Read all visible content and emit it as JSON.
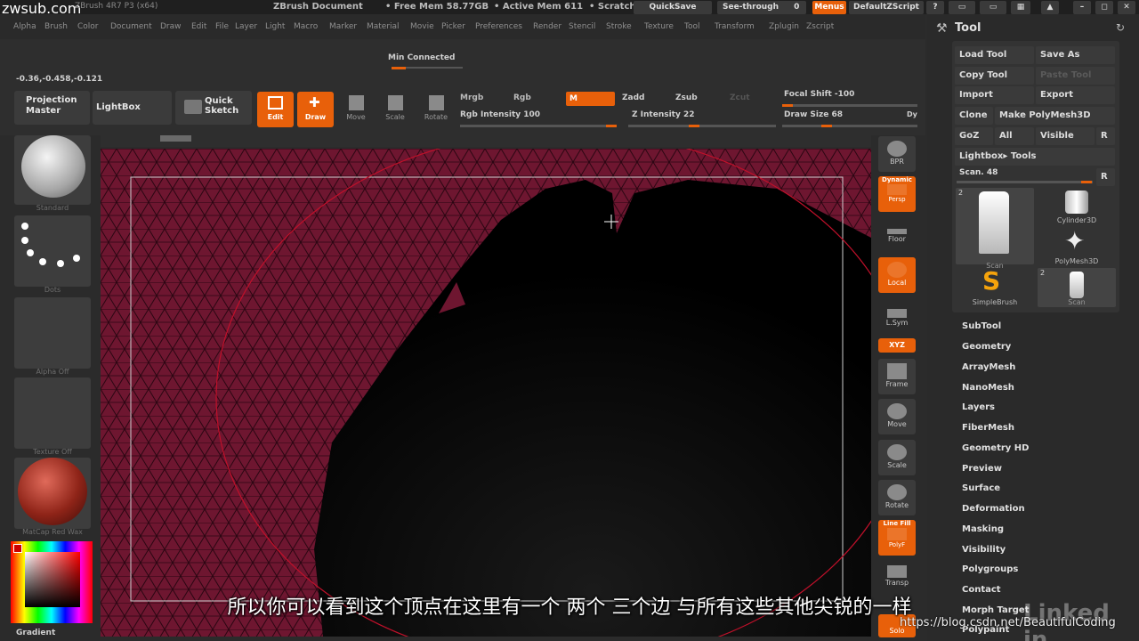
{
  "watermark": "zwsub.com",
  "titlebar": {
    "app_version": "ZBrush 4R7 P3 (x64)",
    "document": "ZBrush Document",
    "free_mem": "• Free Mem 58.77GB",
    "active_mem": "• Active Mem 611",
    "scratch": "• Scratch",
    "quicksave": "QuickSave",
    "see_through": "See-through",
    "see_through_value": "0",
    "menus": "Menus",
    "default_zscript": "DefaultZScript"
  },
  "menu": [
    "Alpha",
    "Brush",
    "Color",
    "Document",
    "Draw",
    "Edit",
    "File",
    "Layer",
    "Light",
    "Macro",
    "Marker",
    "Material",
    "Movie",
    "Picker",
    "Preferences",
    "Render",
    "Stencil",
    "Stroke",
    "Texture",
    "Tool",
    "Transform",
    "Zplugin",
    "Zscript"
  ],
  "status": {
    "connected": "Min Connected",
    "coords": "-0.36,-0.458,-0.121"
  },
  "toolbar": {
    "projection_master": "Projection Master",
    "lightbox": "LightBox",
    "quick_sketch": "Quick Sketch",
    "edit": "Edit",
    "draw": "Draw",
    "move": "Move",
    "scale": "Scale",
    "rotate": "Rotate",
    "mrgb": "Mrgb",
    "rgb": "Rgb",
    "m": "M",
    "zadd": "Zadd",
    "zsub": "Zsub",
    "zcut": "Zcut",
    "rgb_intensity": "Rgb Intensity 100",
    "z_intensity": "Z Intensity 22",
    "focal_shift": "Focal Shift -100",
    "draw_size": "Draw Size 68",
    "dyn": "Dy"
  },
  "left_shelf": {
    "standard": "Standard",
    "dots": "Dots",
    "alpha_off": "Alpha Off",
    "texture_off": "Texture Off",
    "matcap": "MatCap Red Wax",
    "gradient": "Gradient"
  },
  "right_shelf": {
    "bpr": "BPR",
    "dynamic": "Dynamic",
    "persp": "Persp",
    "floor": "Floor",
    "local": "Local",
    "lsym": "L.Sym",
    "xyz": "XYZ",
    "frame": "Frame",
    "move": "Move",
    "scale": "Scale",
    "rotate": "Rotate",
    "line_fill": "Line Fill",
    "polyf": "PolyF",
    "transp": "Transp",
    "solo": "Solo"
  },
  "tool_panel": {
    "title": "Tool",
    "load_tool": "Load Tool",
    "save_as": "Save As",
    "copy_tool": "Copy Tool",
    "paste_tool": "Paste Tool",
    "import": "Import",
    "export": "Export",
    "clone": "Clone",
    "make_polymesh": "Make PolyMesh3D",
    "goz": "GoZ",
    "all": "All",
    "visible": "Visible",
    "r": "R",
    "lightbox_tools": "Lightbox▸ Tools",
    "scan": "Scan. 48",
    "thumbs": [
      {
        "label": "Scan",
        "count": "2"
      },
      {
        "label": "Cylinder3D",
        "count": ""
      },
      {
        "label": "PolyMesh3D",
        "count": ""
      },
      {
        "label": "SimpleBrush",
        "count": ""
      },
      {
        "label": "Scan",
        "count": "2"
      }
    ],
    "items": [
      "SubTool",
      "Geometry",
      "ArrayMesh",
      "NanoMesh",
      "Layers",
      "FiberMesh",
      "Geometry HD",
      "Preview",
      "Surface",
      "Deformation",
      "Masking",
      "Visibility",
      "Polygroups",
      "Contact",
      "Morph Target",
      "Polypaint"
    ]
  },
  "subtitle": "所以你可以看到这个顶点在这里有一个  两个  三个边  与所有这些其他尖锐的一样",
  "url_watermark": "https://blog.csdn.net/BeautifulCoding",
  "linkedin": "Linked in",
  "colors": {
    "accent": "#e8600a",
    "mesh": "#7a1a35"
  }
}
